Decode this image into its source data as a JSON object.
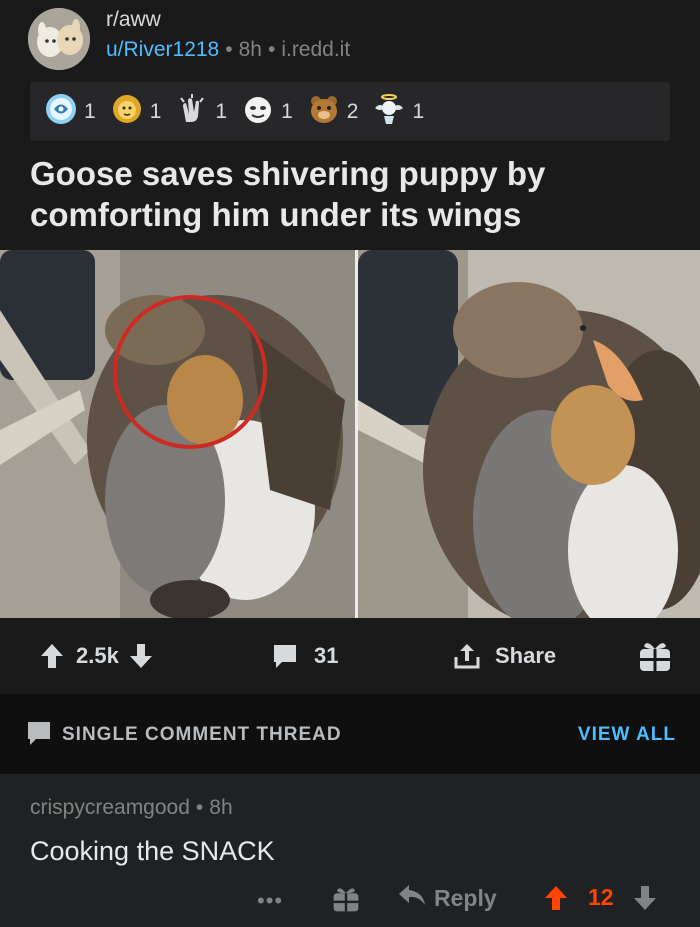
{
  "post": {
    "subreddit": "r/aww",
    "author": "u/River1218",
    "age": "8h",
    "domain": "i.redd.it",
    "separator": "•",
    "title": "Goose saves shivering puppy by comforting him under its wings",
    "awards": [
      {
        "icon": "helpful-award-icon",
        "count": "1"
      },
      {
        "icon": "lion-award-icon",
        "count": "1"
      },
      {
        "icon": "clapping-hands-award-icon",
        "count": "1"
      },
      {
        "icon": "face-award-icon",
        "count": "1"
      },
      {
        "icon": "bear-award-icon",
        "count": "2"
      },
      {
        "icon": "angel-award-icon",
        "count": "1"
      }
    ]
  },
  "actions": {
    "score": "2.5k",
    "comments": "31",
    "share_label": "Share"
  },
  "thread": {
    "label": "SINGLE COMMENT THREAD",
    "view_all": "VIEW ALL"
  },
  "comment": {
    "author": "crispycreamgood",
    "age": "8h",
    "separator": "•",
    "body": "Cooking the SNACK",
    "more": "•••",
    "reply_label": "Reply",
    "score": "12"
  },
  "colors": {
    "background": "#1a1a1b",
    "link": "#4fbcff",
    "upvote": "#ff4500",
    "muted": "#818384"
  }
}
